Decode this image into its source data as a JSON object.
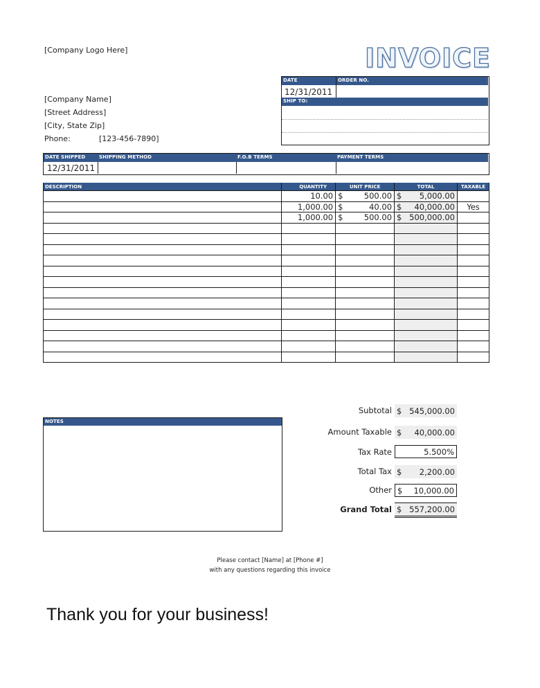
{
  "company": {
    "logo_placeholder": "[Company Logo Here]",
    "name": "[Company Name]",
    "street": "[Street Address]",
    "city": "[City, State Zip]",
    "phone_label": "Phone:",
    "phone": "[123-456-7890]"
  },
  "title": "INVOICE",
  "header_box": {
    "date_label": "Date",
    "order_label": "Order No.",
    "date": "12/31/2011",
    "order_no": "",
    "ship_to_label": "Ship To:",
    "ship_to_lines": [
      "",
      "",
      ""
    ]
  },
  "shipping": {
    "headers": [
      "Date Shipped",
      "Shipping Method",
      "F.O.B Terms",
      "Payment Terms"
    ],
    "values": [
      "12/31/2011",
      "",
      "",
      ""
    ]
  },
  "items": {
    "headers": [
      "Description",
      "Quantity",
      "Unit Price",
      "Total",
      "Taxable"
    ],
    "currency": "$",
    "rows": [
      {
        "description": "",
        "quantity": "10.00",
        "unit_price": "500.00",
        "total": "5,000.00",
        "taxable": ""
      },
      {
        "description": "",
        "quantity": "1,000.00",
        "unit_price": "40.00",
        "total": "40,000.00",
        "taxable": "Yes"
      },
      {
        "description": "",
        "quantity": "1,000.00",
        "unit_price": "500.00",
        "total": "500,000.00",
        "taxable": ""
      },
      {
        "description": "",
        "quantity": "",
        "unit_price": "",
        "total": "",
        "taxable": ""
      },
      {
        "description": "",
        "quantity": "",
        "unit_price": "",
        "total": "",
        "taxable": ""
      },
      {
        "description": "",
        "quantity": "",
        "unit_price": "",
        "total": "",
        "taxable": ""
      },
      {
        "description": "",
        "quantity": "",
        "unit_price": "",
        "total": "",
        "taxable": ""
      },
      {
        "description": "",
        "quantity": "",
        "unit_price": "",
        "total": "",
        "taxable": ""
      },
      {
        "description": "",
        "quantity": "",
        "unit_price": "",
        "total": "",
        "taxable": ""
      },
      {
        "description": "",
        "quantity": "",
        "unit_price": "",
        "total": "",
        "taxable": ""
      },
      {
        "description": "",
        "quantity": "",
        "unit_price": "",
        "total": "",
        "taxable": ""
      },
      {
        "description": "",
        "quantity": "",
        "unit_price": "",
        "total": "",
        "taxable": ""
      },
      {
        "description": "",
        "quantity": "",
        "unit_price": "",
        "total": "",
        "taxable": ""
      },
      {
        "description": "",
        "quantity": "",
        "unit_price": "",
        "total": "",
        "taxable": ""
      },
      {
        "description": "",
        "quantity": "",
        "unit_price": "",
        "total": "",
        "taxable": ""
      },
      {
        "description": "",
        "quantity": "",
        "unit_price": "",
        "total": "",
        "taxable": ""
      }
    ]
  },
  "notes": {
    "label": "Notes",
    "text": ""
  },
  "summary": {
    "currency": "$",
    "subtotal_label": "Subtotal",
    "subtotal": "545,000.00",
    "amount_taxable_label": "Amount Taxable",
    "amount_taxable": "40,000.00",
    "tax_rate_label": "Tax Rate",
    "tax_rate": "5.500%",
    "total_tax_label": "Total Tax",
    "total_tax": "2,200.00",
    "other_label": "Other",
    "other": "10,000.00",
    "grand_total_label": "Grand Total",
    "grand_total": "557,200.00"
  },
  "footer": {
    "contact_line1": "Please contact [Name] at [Phone #]",
    "contact_line2": "with any questions regarding this invoice",
    "thanks": "Thank you for your business!"
  }
}
